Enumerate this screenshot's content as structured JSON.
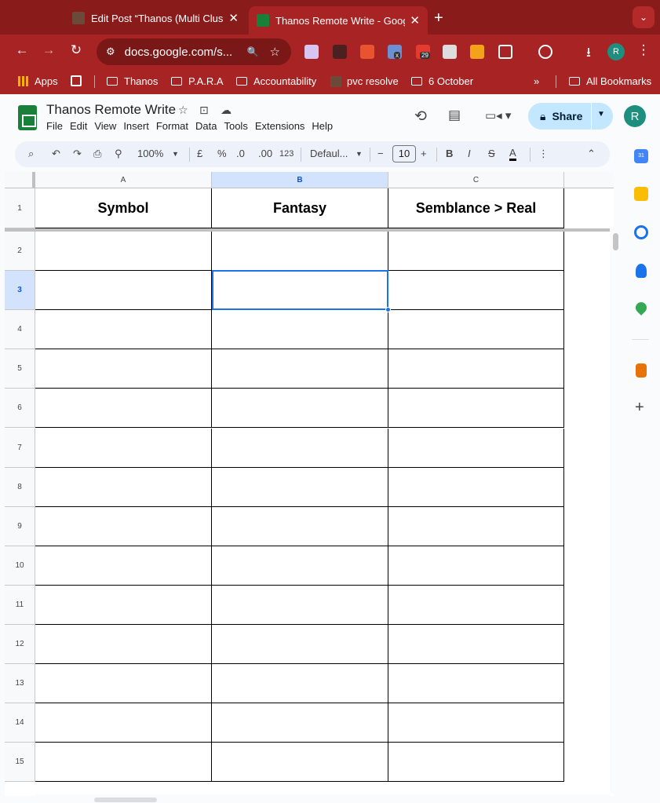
{
  "tabs": [
    {
      "title": "Edit Post “Thanos (Multi Clus",
      "close": "✕"
    },
    {
      "title": "Thanos Remote Write - Goog",
      "close": "✕"
    }
  ],
  "newtab": "+",
  "tabsearch": "⌄",
  "toolbar": {
    "back": "←",
    "forward": "→",
    "reload": "↻",
    "siteinfo": "⚙",
    "url": "docs.google.com/s...",
    "zoom": "🔍",
    "star": "☆",
    "download": "⭳",
    "profile": "R",
    "menu": "⋮",
    "ext_badge_1": "x",
    "ext_badge_2": "29"
  },
  "bookmarks": [
    {
      "label": "Apps"
    },
    {
      "label": "Thanos"
    },
    {
      "label": "P.A.R.A"
    },
    {
      "label": "Accountability"
    },
    {
      "label": "pvc resolve"
    },
    {
      "label": "6 October"
    },
    {
      "label": "All Bookmarks"
    }
  ],
  "bookmarks_more": "»",
  "doc": {
    "title": "Thanos Remote Write",
    "menus": [
      "File",
      "Edit",
      "View",
      "Insert",
      "Format",
      "Data",
      "Tools",
      "Extensions",
      "Help"
    ],
    "share_label": "Share",
    "account": "R"
  },
  "sheet_toolbar": {
    "zoom": "100%",
    "currency": "£",
    "percent": "%",
    "dec_decrease": ".0",
    "dec_increase": ".00",
    "number_format": "123",
    "font": "Defaul...",
    "font_size": "10",
    "bold": "B",
    "italic": "I",
    "strike": "S",
    "text_color": "A",
    "minus": "−",
    "plus": "+",
    "more": "⋮",
    "collapse": "⌃"
  },
  "grid": {
    "columns": [
      "A",
      "B",
      "C"
    ],
    "selected_column": "B",
    "rows": [
      "1",
      "2",
      "3",
      "4",
      "5",
      "6",
      "7",
      "8",
      "9",
      "10",
      "11",
      "12",
      "13",
      "14",
      "15"
    ],
    "selected_row": "3",
    "header_cells": [
      "Symbol",
      "Fantasy",
      "Semblance > Real"
    ]
  },
  "side_panel": {
    "add": "+",
    "calendar_day": "31"
  },
  "colors": {
    "chrome_dark": "#8a1b1b",
    "chrome": "#a82323",
    "sheets_green": "#188038",
    "share_bg": "#c2e7ff",
    "selection": "#1a73e8",
    "avatar": "#1e8e7e"
  }
}
